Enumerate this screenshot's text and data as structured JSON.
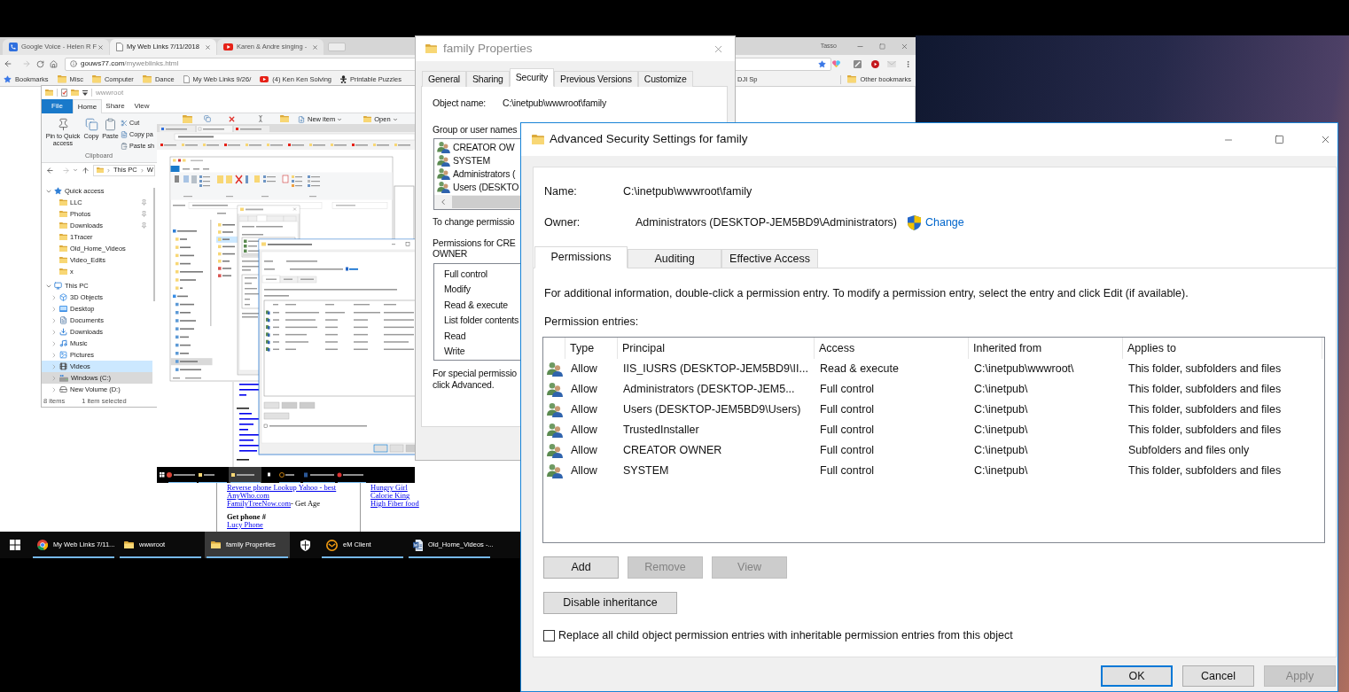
{
  "browser": {
    "tabs": [
      {
        "kind": "voice",
        "title": "Google Voice - Helen R F",
        "selected": false
      },
      {
        "kind": "page",
        "title": "My Web Links 7/11/2018",
        "selected": true
      },
      {
        "kind": "video",
        "title": "Karen & Andre singing -",
        "selected": false
      }
    ],
    "profile": "Tasso",
    "address": {
      "host": "gouws77.com",
      "path": "/myweblinks.html",
      "bookmarked": true
    },
    "bookmarks": [
      {
        "kind": "star",
        "label": "Bookmarks"
      },
      {
        "kind": "folder",
        "label": "Misc"
      },
      {
        "kind": "folder",
        "label": "Computer"
      },
      {
        "kind": "folder",
        "label": "Dance"
      },
      {
        "kind": "page",
        "label": "My Web Links 9/26/"
      },
      {
        "kind": "video",
        "label": "(4) Ken Ken Solving"
      },
      {
        "kind": "puzzle",
        "label": "Printable Puzzles"
      }
    ],
    "cut_bookmark": "DJI Sp",
    "other_bookmarks": "Other bookmarks",
    "page": {
      "left": [
        {
          "kind": "link",
          "text": "Reverse phone Lookup Yahoo - best"
        },
        {
          "kind": "link",
          "text": "AnyWho.com"
        },
        {
          "kind": "link",
          "text": "FamilyTreeNow.com",
          "note": "- Get Age"
        },
        {
          "kind": "heading",
          "text": "Get phone #"
        },
        {
          "kind": "link",
          "text": "Lucy Phone"
        }
      ],
      "right": [
        {
          "kind": "link",
          "text": "Hungry Girl"
        },
        {
          "kind": "link",
          "text": "Calorie King"
        },
        {
          "kind": "link",
          "text": "High Fiber food"
        }
      ]
    }
  },
  "explorer": {
    "title": "wwwroot",
    "ribbon_tabs": [
      {
        "kind": "file",
        "label": "File",
        "selected": false
      },
      {
        "kind": "tab",
        "label": "Home",
        "selected": true
      },
      {
        "kind": "tab",
        "label": "Share",
        "selected": false
      },
      {
        "kind": "tab",
        "label": "View",
        "selected": false
      }
    ],
    "clipboard": {
      "large": [
        {
          "kind": "pin",
          "label": "Pin to Quick access"
        },
        {
          "kind": "copy",
          "label": "Copy"
        },
        {
          "kind": "paste",
          "label": "Paste"
        }
      ],
      "small": [
        {
          "kind": "cut",
          "label": "Cut"
        },
        {
          "kind": "copy-path",
          "label": "Copy pa"
        },
        {
          "kind": "paste-shortcut",
          "label": "Paste sh"
        }
      ],
      "group": "Clipboard"
    },
    "ribbon_more": [
      {
        "kind": "new-item",
        "label": "New item"
      },
      {
        "kind": "open",
        "label": "Open"
      }
    ],
    "breadcrumb": [
      "This PC",
      "W"
    ],
    "tree": [
      {
        "kind": "star",
        "label": "Quick access",
        "expanded": true,
        "selected": false,
        "hovered": false,
        "children": [
          {
            "kind": "folder",
            "label": "LLC",
            "pinned": true,
            "selected": false,
            "hovered": false
          },
          {
            "kind": "folder",
            "label": "Photos",
            "pinned": true,
            "selected": false,
            "hovered": false
          },
          {
            "kind": "folder",
            "label": "Downloads",
            "pinned": true,
            "selected": false,
            "hovered": false
          },
          {
            "kind": "folder",
            "label": "1Tracer",
            "pinned": false,
            "selected": false,
            "hovered": false
          },
          {
            "kind": "folder",
            "label": "Old_Home_Videos",
            "pinned": false,
            "selected": false,
            "hovered": false
          },
          {
            "kind": "folder",
            "label": "Video_Edits",
            "pinned": false,
            "selected": false,
            "hovered": false
          },
          {
            "kind": "folder",
            "label": "x",
            "pinned": false,
            "selected": false,
            "hovered": false
          }
        ]
      },
      {
        "kind": "pc",
        "label": "This PC",
        "expanded": true,
        "selected": false,
        "hovered": false,
        "children": [
          {
            "kind": "objects",
            "label": "3D Objects",
            "expanded": false,
            "selected": false,
            "hovered": false
          },
          {
            "kind": "desktop",
            "label": "Desktop",
            "expanded": false,
            "selected": false,
            "hovered": false
          },
          {
            "kind": "documents",
            "label": "Documents",
            "expanded": false,
            "selected": false,
            "hovered": false
          },
          {
            "kind": "downloads",
            "label": "Downloads",
            "expanded": false,
            "selected": false,
            "hovered": false
          },
          {
            "kind": "music",
            "label": "Music",
            "expanded": false,
            "selected": false,
            "hovered": false
          },
          {
            "kind": "pictures",
            "label": "Pictures",
            "expanded": false,
            "selected": false,
            "hovered": false
          },
          {
            "kind": "videos",
            "label": "Videos",
            "expanded": false,
            "selected": false,
            "hovered": true
          },
          {
            "kind": "drive-c",
            "label": "Windows (C:)",
            "expanded": false,
            "selected": true,
            "hovered": false
          },
          {
            "kind": "drive",
            "label": "New Volume (D:)",
            "expanded": false,
            "selected": false,
            "hovered": false
          }
        ]
      }
    ],
    "status": [
      "8 items",
      "1 item selected"
    ]
  },
  "properties": {
    "title": "family Properties",
    "tabs": [
      {
        "label": "General",
        "selected": false
      },
      {
        "label": "Sharing",
        "selected": false
      },
      {
        "label": "Security",
        "selected": true
      },
      {
        "label": "Previous Versions",
        "selected": false
      },
      {
        "label": "Customize",
        "selected": false
      }
    ],
    "object_label": "Object name:",
    "object_value": "C:\\inetpub\\wwwroot\\family",
    "groups_label": "Group or user names",
    "groups": [
      "CREATOR OW",
      "SYSTEM",
      "Administrators (",
      "Users (DESKTO"
    ],
    "change_note": "To change permissio",
    "permissions_for": [
      "Permissions for CRE",
      "OWNER"
    ],
    "permissions": [
      "Full control",
      "Modify",
      "Read & execute",
      "List folder contents",
      "Read",
      "Write"
    ],
    "special_note": [
      "For special permissio",
      "click Advanced."
    ]
  },
  "advanced": {
    "title": "Advanced Security Settings for family",
    "name_label": "Name:",
    "name": "C:\\inetpub\\wwwroot\\family",
    "owner_label": "Owner:",
    "owner": "Administrators (DESKTOP-JEM5BD9\\Administrators)",
    "change": "Change",
    "tabs": [
      {
        "label": "Permissions",
        "selected": true
      },
      {
        "label": "Auditing",
        "selected": false
      },
      {
        "label": "Effective Access",
        "selected": false
      }
    ],
    "info": "For additional information, double-click a permission entry. To modify a permission entry, select the entry and click Edit (if available).",
    "entries_label": "Permission entries:",
    "columns": [
      "Type",
      "Principal",
      "Access",
      "Inherited from",
      "Applies to"
    ],
    "rows": [
      {
        "type": "Allow",
        "principal": "IIS_IUSRS (DESKTOP-JEM5BD9\\II...",
        "access": "Read & execute",
        "inherited": "C:\\inetpub\\wwwroot\\",
        "applies": "This folder, subfolders and files"
      },
      {
        "type": "Allow",
        "principal": "Administrators (DESKTOP-JEM5...",
        "access": "Full control",
        "inherited": "C:\\inetpub\\",
        "applies": "This folder, subfolders and files"
      },
      {
        "type": "Allow",
        "principal": "Users (DESKTOP-JEM5BD9\\Users)",
        "access": "Full control",
        "inherited": "C:\\inetpub\\",
        "applies": "This folder, subfolders and files"
      },
      {
        "type": "Allow",
        "principal": "TrustedInstaller",
        "access": "Full control",
        "inherited": "C:\\inetpub\\",
        "applies": "This folder, subfolders and files"
      },
      {
        "type": "Allow",
        "principal": "CREATOR OWNER",
        "access": "Full control",
        "inherited": "C:\\inetpub\\",
        "applies": "Subfolders and files only"
      },
      {
        "type": "Allow",
        "principal": "SYSTEM",
        "access": "Full control",
        "inherited": "C:\\inetpub\\",
        "applies": "This folder, subfolders and files"
      }
    ],
    "actions": [
      {
        "label": "Add",
        "disabled": false
      },
      {
        "label": "Remove",
        "disabled": true
      },
      {
        "label": "View",
        "disabled": true
      }
    ],
    "disable_inheritance": "Disable inheritance",
    "replace": {
      "label": "Replace all child object permission entries with inheritable permission entries from this object",
      "checked": false
    },
    "footer": [
      {
        "label": "OK",
        "default": true,
        "disabled": false
      },
      {
        "label": "Cancel",
        "default": false,
        "disabled": false
      },
      {
        "label": "Apply",
        "default": false,
        "disabled": true
      }
    ]
  },
  "taskbar": {
    "items": [
      {
        "kind": "chrome",
        "label": "My Web Links 7/11...",
        "selected": false,
        "running": true
      },
      {
        "kind": "folder",
        "label": "wwwroot",
        "selected": false,
        "running": true
      },
      {
        "kind": "folder",
        "label": "family Properties",
        "selected": true,
        "running": true
      },
      {
        "kind": "shield",
        "selected": false,
        "running": false
      },
      {
        "kind": "mail",
        "label": "eM Client",
        "selected": false,
        "running": true
      },
      {
        "kind": "document",
        "label": "Old_Home_Videos -...",
        "selected": false,
        "running": true
      }
    ]
  }
}
